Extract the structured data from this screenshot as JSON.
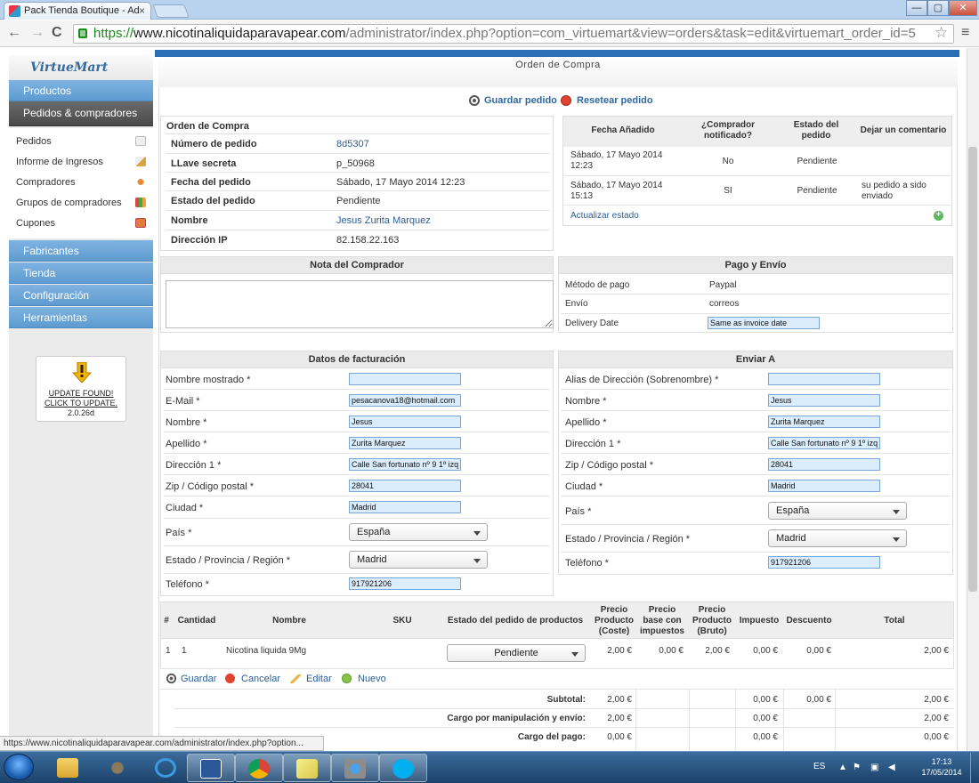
{
  "browser": {
    "tab_title": "Pack Tienda Boutique - Ad",
    "tab_close": "×",
    "url_scheme": "https://",
    "url_host": "www.nicotinaliquidaparavapear.com",
    "url_path": "/administrator/index.php?option=com_virtuemart&view=orders&task=edit&virtuemart_order_id=5",
    "back": "←",
    "forward": "→",
    "reload": "C",
    "star": "☆",
    "menu": "≡",
    "win_min": "—",
    "win_max": "▢",
    "win_close": "✕",
    "status_url": "https://www.nicotinaliquidaparavapear.com/administrator/index.php?option..."
  },
  "sidebar": {
    "logo": "VirtueMart",
    "products": "Productos",
    "orders_section": "Pedidos & compradores",
    "sub_items": [
      "Pedidos",
      "Informe de Ingresos",
      "Compradores",
      "Grupos de compradores",
      "Cupones"
    ],
    "manufacturers": "Fabricantes",
    "store": "Tienda",
    "configuration": "Configuración",
    "tools": "Herramientas",
    "update_line1": "UPDATE FOUND!",
    "update_line2": "CLICK TO UPDATE.",
    "update_version": "2.0.26d"
  },
  "page": {
    "title": "Orden de Compra",
    "save_label": "Guardar pedido",
    "reset_label": "Resetear pedido"
  },
  "order": {
    "heading": "Orden de Compra",
    "rows": [
      {
        "label": "Número de pedido",
        "value": "8d5307"
      },
      {
        "label": "LLave secreta",
        "value": "p_50968"
      },
      {
        "label": "Fecha del pedido",
        "value": "Sábado, 17 Mayo 2014 12:23"
      },
      {
        "label": "Estado del pedido",
        "value": "Pendiente"
      },
      {
        "label": "Nombre",
        "value": "Jesus Zurita Marquez"
      },
      {
        "label": "Dirección IP",
        "value": "82.158.22.163"
      }
    ]
  },
  "history": {
    "headers": [
      "Fecha Añadido",
      "¿Comprador notificado?",
      "Estado del pedido",
      "Dejar un comentario"
    ],
    "rows": [
      {
        "date": "Sábado, 17 Mayo 2014 12:23",
        "notified": "No",
        "status": "Pendiente",
        "comment": ""
      },
      {
        "date": "Sábado, 17 Mayo 2014 15:13",
        "notified": "SI",
        "status": "Pendiente",
        "comment": "su pedido a sido enviado"
      }
    ],
    "update_link": "Actualizar estado"
  },
  "buyer_note": {
    "heading": "Nota del Comprador",
    "value": ""
  },
  "payment": {
    "heading": "Pago y Envío",
    "method_label": "Método de pago",
    "method_value": "Paypal",
    "shipping_label": "Envío",
    "shipping_value": "correos",
    "delivery_label": "Delivery Date",
    "delivery_value": "Same as invoice date"
  },
  "billing": {
    "heading": "Datos de facturación",
    "fields": [
      {
        "label": "Nombre mostrado *",
        "value": ""
      },
      {
        "label": "E-Mail *",
        "value": "pesacanova18@hotmail.com"
      },
      {
        "label": "Nombre *",
        "value": "Jesus"
      },
      {
        "label": "Apellido *",
        "value": "Zurita Marquez"
      },
      {
        "label": "Dirección 1 *",
        "value": "Calle San fortunato nº 9 1º izq"
      },
      {
        "label": "Zip / Código postal *",
        "value": "28041"
      },
      {
        "label": "Ciudad *",
        "value": "Madrid"
      }
    ],
    "country_label": "País *",
    "country_value": "España",
    "state_label": "Estado / Provincia / Región *",
    "state_value": "Madrid",
    "phone_label": "Teléfono *",
    "phone_value": "917921206"
  },
  "shipping": {
    "heading": "Enviar A",
    "fields": [
      {
        "label": "Alias de Dirección (Sobrenombre) *",
        "value": ""
      },
      {
        "label": "Nombre *",
        "value": "Jesus"
      },
      {
        "label": "Apellido *",
        "value": "Zurita Marquez"
      },
      {
        "label": "Dirección 1 *",
        "value": "Calle San fortunato nº 9 1º izq"
      },
      {
        "label": "Zip / Código postal *",
        "value": "28041"
      },
      {
        "label": "Ciudad *",
        "value": "Madrid"
      }
    ],
    "country_label": "País *",
    "country_value": "España",
    "state_label": "Estado / Provincia / Región *",
    "state_value": "Madrid",
    "phone_label": "Teléfono *",
    "phone_value": "917921206"
  },
  "items": {
    "headers": {
      "num": "#",
      "qty": "Cantidad",
      "name": "Nombre",
      "sku": "SKU",
      "status": "Estado del pedido de productos",
      "cost_1": "Precio",
      "cost_2": "Producto",
      "cost_3": "(Coste)",
      "base_1": "Precio",
      "base_2": "base con",
      "base_3": "impuestos",
      "gross_1": "Precio",
      "gross_2": "Producto",
      "gross_3": "(Bruto)",
      "tax": "Impuesto",
      "discount": "Descuento",
      "total": "Total"
    },
    "row": {
      "num": "1",
      "qty": "1",
      "name": "Nicotina liquida 9Mg",
      "sku": "",
      "status": "Pendiente",
      "cost": "2,00 €",
      "base": "0,00 €",
      "gross": "2,00 €",
      "tax": "0,00 €",
      "discount": "0,00 €",
      "total": "2,00 €"
    },
    "actions": {
      "save": "Guardar",
      "cancel": "Cancelar",
      "edit": "Editar",
      "new": "Nuevo"
    },
    "summary": [
      {
        "label": "Subtotal:",
        "cost": "2,00 €",
        "tax": "0,00 €",
        "discount": "0,00 €",
        "total": "2,00 €"
      },
      {
        "label": "Cargo por manipulación y envío:",
        "cost": "2,00 €",
        "tax": "0,00 €",
        "discount": "",
        "total": "2,00 €"
      },
      {
        "label": "Cargo del pago:",
        "cost": "0,00 €",
        "tax": "0,00 €",
        "discount": "",
        "total": "0,00 €"
      }
    ]
  },
  "taskbar": {
    "lang": "ES",
    "time": "17:13",
    "date": "17/05/2014"
  }
}
